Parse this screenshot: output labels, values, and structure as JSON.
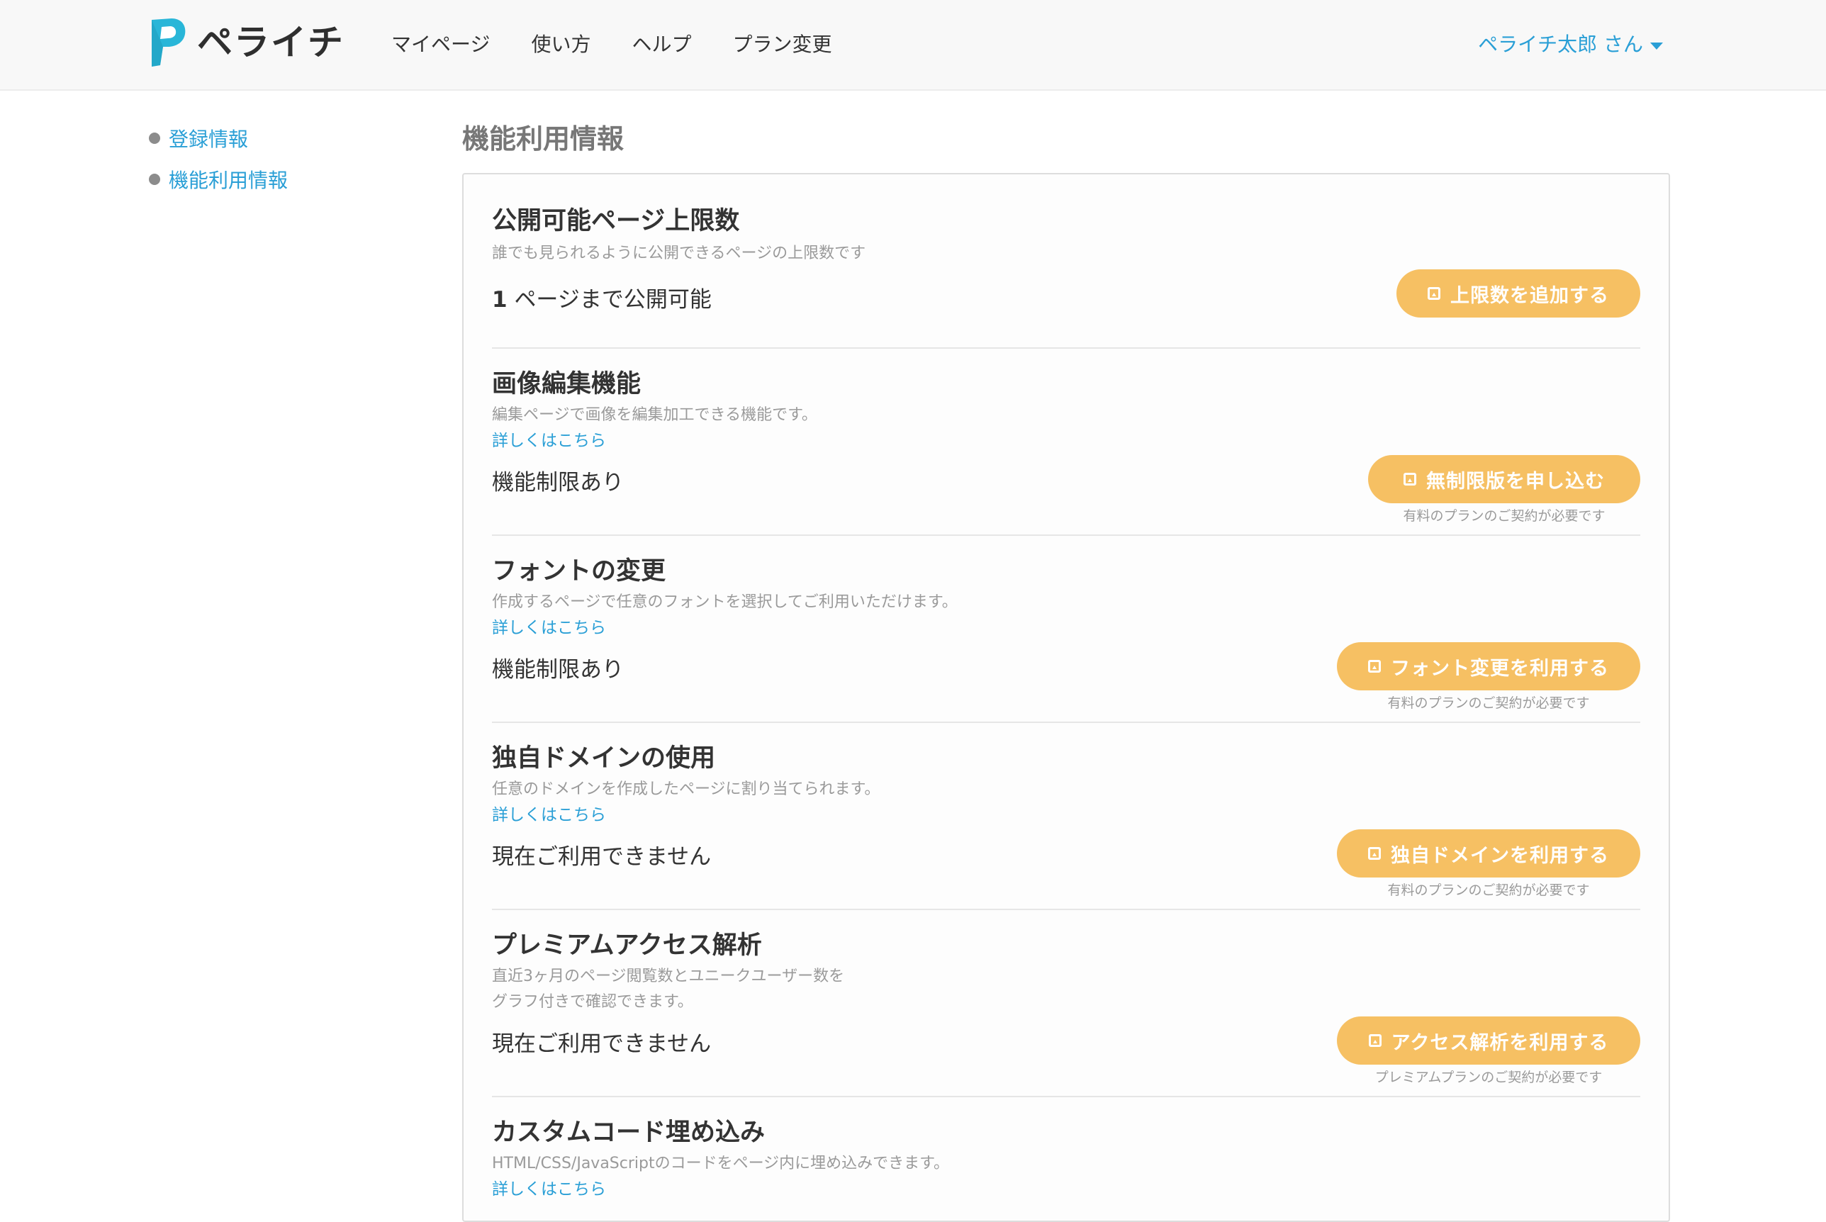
{
  "header": {
    "logo_text": "ペライチ",
    "brand_color": "#29b6d8",
    "nav": [
      "マイページ",
      "使い方",
      "ヘルプ",
      "プラン変更"
    ],
    "user_label": "ペライチ太郎 さん"
  },
  "sidebar": {
    "items": [
      {
        "label": "登録情報"
      },
      {
        "label": "機能利用情報"
      }
    ]
  },
  "main": {
    "title": "機能利用情報",
    "features": [
      {
        "title": "公開可能ページ上限数",
        "description": "誰でも見られるように公開できるページの上限数です",
        "status_number": "1",
        "status": "ページまで公開可能",
        "button_label": "上限数を追加する"
      },
      {
        "title": "画像編集機能",
        "description": "編集ページで画像を編集加工できる機能です。",
        "link": "詳しくはこちら",
        "status": "機能制限あり",
        "button_label": "無制限版を申し込む",
        "note": "有料のプランのご契約が必要です"
      },
      {
        "title": "フォントの変更",
        "description": "作成するページで任意のフォントを選択してご利用いただけます。",
        "link": "詳しくはこちら",
        "status": "機能制限あり",
        "button_label": "フォント変更を利用する",
        "note": "有料のプランのご契約が必要です"
      },
      {
        "title": "独自ドメインの使用",
        "description": "任意のドメインを作成したページに割り当てられます。",
        "link": "詳しくはこちら",
        "status": "現在ご利用できません",
        "button_label": "独自ドメインを利用する",
        "note": "有料のプランのご契約が必要です"
      },
      {
        "title": "プレミアムアクセス解析",
        "description": "直近3ヶ月のページ閲覧数とユニークユーザー数を\nグラフ付きで確認できます。",
        "status": "現在ご利用できません",
        "button_label": "アクセス解析を利用する",
        "note": "プレミアムプランのご契約が必要です"
      },
      {
        "title": "カスタムコード埋め込み",
        "description": "HTML/CSS/JavaScriptのコードをページ内に埋め込みできます。",
        "link": "詳しくはこちら"
      }
    ]
  },
  "colors": {
    "link": "#2a9fd6",
    "button": "#f6c063",
    "title_gray": "#777777"
  }
}
